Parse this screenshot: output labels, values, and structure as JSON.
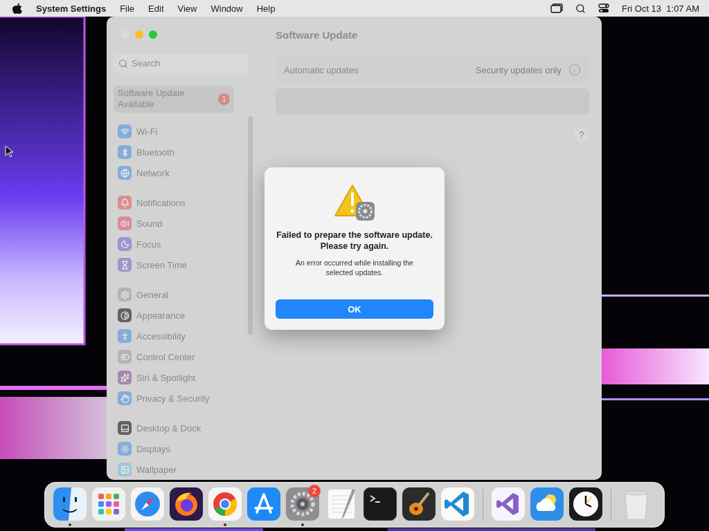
{
  "menubar": {
    "app": "System Settings",
    "menus": [
      "File",
      "Edit",
      "View",
      "Window",
      "Help"
    ],
    "clock": "Fri Oct 13  1:07 AM"
  },
  "window": {
    "title": "Software Update",
    "search": {
      "placeholder": "Search"
    },
    "update_item": {
      "label": "Software Update Available",
      "badge": "1",
      "selected": true
    },
    "sidebar": {
      "sections": [
        {
          "items": [
            {
              "label": "Wi-Fi",
              "kind": "wifi",
              "color": "#86acd8",
              "selected": false
            },
            {
              "label": "Bluetooth",
              "kind": "bluetooth",
              "color": "#86acd8",
              "selected": false
            },
            {
              "label": "Network",
              "kind": "network",
              "color": "#86acd8",
              "selected": false
            }
          ]
        },
        {
          "items": [
            {
              "label": "Notifications",
              "kind": "notifications",
              "color": "#d98f8f",
              "selected": false
            },
            {
              "label": "Sound",
              "kind": "sound",
              "color": "#d98a9c",
              "selected": false
            },
            {
              "label": "Focus",
              "kind": "focus",
              "color": "#9d95cc",
              "selected": false
            },
            {
              "label": "Screen Time",
              "kind": "screentime",
              "color": "#9d95cc",
              "selected": false
            }
          ]
        },
        {
          "items": [
            {
              "label": "General",
              "kind": "general",
              "color": "#b4b4b4",
              "selected": false
            },
            {
              "label": "Appearance",
              "kind": "appearance",
              "color": "#626262",
              "selected": false
            },
            {
              "label": "Accessibility",
              "kind": "accessibility",
              "color": "#86acd8",
              "selected": false
            },
            {
              "label": "Control Center",
              "kind": "controlcenter",
              "color": "#b4b4b4",
              "selected": false
            },
            {
              "label": "Siri & Spotlight",
              "kind": "siri",
              "color": "#a48aae",
              "selected": false
            },
            {
              "label": "Privacy & Security",
              "kind": "privacy",
              "color": "#86acd8",
              "selected": false
            }
          ]
        },
        {
          "items": [
            {
              "label": "Desktop & Dock",
              "kind": "dock",
              "color": "#626262",
              "selected": false
            },
            {
              "label": "Displays",
              "kind": "displays",
              "color": "#86acd8",
              "selected": false
            },
            {
              "label": "Wallpaper",
              "kind": "wallpaper",
              "color": "#9ec8dc",
              "selected": false
            }
          ]
        }
      ]
    },
    "automatic_updates": {
      "label": "Automatic updates",
      "value": "Security updates only"
    },
    "help": "?"
  },
  "dialog": {
    "title": "Failed to prepare the software update. Please try again.",
    "message": "An error occurred while installing the selected updates.",
    "button": "OK"
  },
  "dock": {
    "apps": [
      {
        "kind": "finder",
        "running": true
      },
      {
        "kind": "launchpad",
        "running": false
      },
      {
        "kind": "safari",
        "running": false
      },
      {
        "kind": "firefox",
        "running": false
      },
      {
        "kind": "chrome",
        "running": true
      },
      {
        "kind": "appstore",
        "running": false
      },
      {
        "kind": "settings",
        "running": true,
        "badge": "2"
      },
      {
        "kind": "textedit",
        "running": false
      },
      {
        "kind": "terminal",
        "running": false
      },
      {
        "kind": "garageband",
        "running": false
      },
      {
        "kind": "vscode",
        "running": false
      }
    ],
    "others": [
      {
        "kind": "visualstudio",
        "running": false
      },
      {
        "kind": "weather",
        "running": false
      },
      {
        "kind": "clock",
        "running": false
      }
    ]
  }
}
